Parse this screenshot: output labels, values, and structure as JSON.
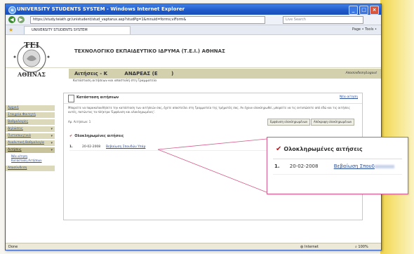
{
  "browser": {
    "title": "UNIVERSITY STUDENTS SYSTEM - Windows Internet Explorer",
    "address": "https://study.teiath.gr/unistudent/stud_vaptarux.asp?studPg=1&mnuid=forms;viForm&",
    "search_placeholder": "Live Search",
    "tab_label": "UNIVERSITY STUDENTS SYSTEM",
    "tools_label": "Page • Tools •"
  },
  "header": {
    "logo_text": "ΤΕΙ ΑΘΗΝΑΣ",
    "institution": "ΤΕΧΝΟΛΟΓΙΚΟ ΕΚΠΑΙΔΕΥΤΙΚΟ ΙΔΡΥΜΑ (Τ.Ε.Ι.) ΑΘΗΝΑΣ",
    "section": "Αιτήσεις - Κ",
    "student": "ΑΝΔΡΕΑΣ (Ε",
    "student_suffix": ")",
    "logout": "Αποσύνδεση/Logout",
    "subtitle": "Κατάσταση αιτήσεων και αποστολή στη Γραμματεία"
  },
  "sidebar": {
    "items": [
      {
        "label": "Αρχική",
        "chevron": ""
      },
      {
        "label": "Στοιχεία Φοιτητή",
        "chevron": ""
      },
      {
        "label": "Βαθμολογίες",
        "chevron": ""
      },
      {
        "label": "Δηλώσεις",
        "chevron": "▾"
      },
      {
        "label": "Πιστοποιητικά",
        "chevron": "▾"
      },
      {
        "label": "Αναλυτική Βαθμολογία",
        "chevron": "▾"
      },
      {
        "label": "Αιτήσεις",
        "chevron": "▾"
      }
    ],
    "sub_items": [
      "Νέα αίτηση",
      "Κατάσταση Αιτήσεων"
    ],
    "logout": "Αποσύνδεση"
  },
  "main": {
    "title": "Κατάσταση αιτήσεων",
    "new_link": "Νέα αίτηση",
    "description": "Μπορείτε να παρακολουθήσετε την κατάσταση των αιτήσεών σας, έχετε αποστείλει στη Γραμματεία της τμήματός σας. Αν έχουν ολοκληρωθεί, μπορείτε να τις εκτυπώσετε από εδώ και τις αιτήσεις αυτές, πατώντας τα πλήκτρα 'Εμφάνιση και ολοκληρωμένες'.",
    "count_label": "Αρ. Αιτήσεων: 1",
    "btn_show": "Εμφάνιση ολοκληρωμένων",
    "btn_hide": "Απόκρυψη ολοκληρωμένων",
    "completed_title": "Ολοκληρωμένες αιτήσεις",
    "rows": [
      {
        "num": "1.",
        "date": "20-02-2008",
        "link": "Βεβαίωση Σπουδών Υπάρ"
      }
    ]
  },
  "callout": {
    "title": "Ολοκληρωμένες αιτήσεις",
    "num": "1.",
    "date": "20-02-2008",
    "link": "Βεβαίωση Σπουδ"
  },
  "status": {
    "left": "Done",
    "zone": "Internet",
    "zoom": "100%"
  },
  "colors": {
    "titlebar": "#1e58c9",
    "bar": "#d3d0ad",
    "link": "#2a4d9b",
    "check": "#c0161b",
    "callout_border": "#d55a8c"
  }
}
